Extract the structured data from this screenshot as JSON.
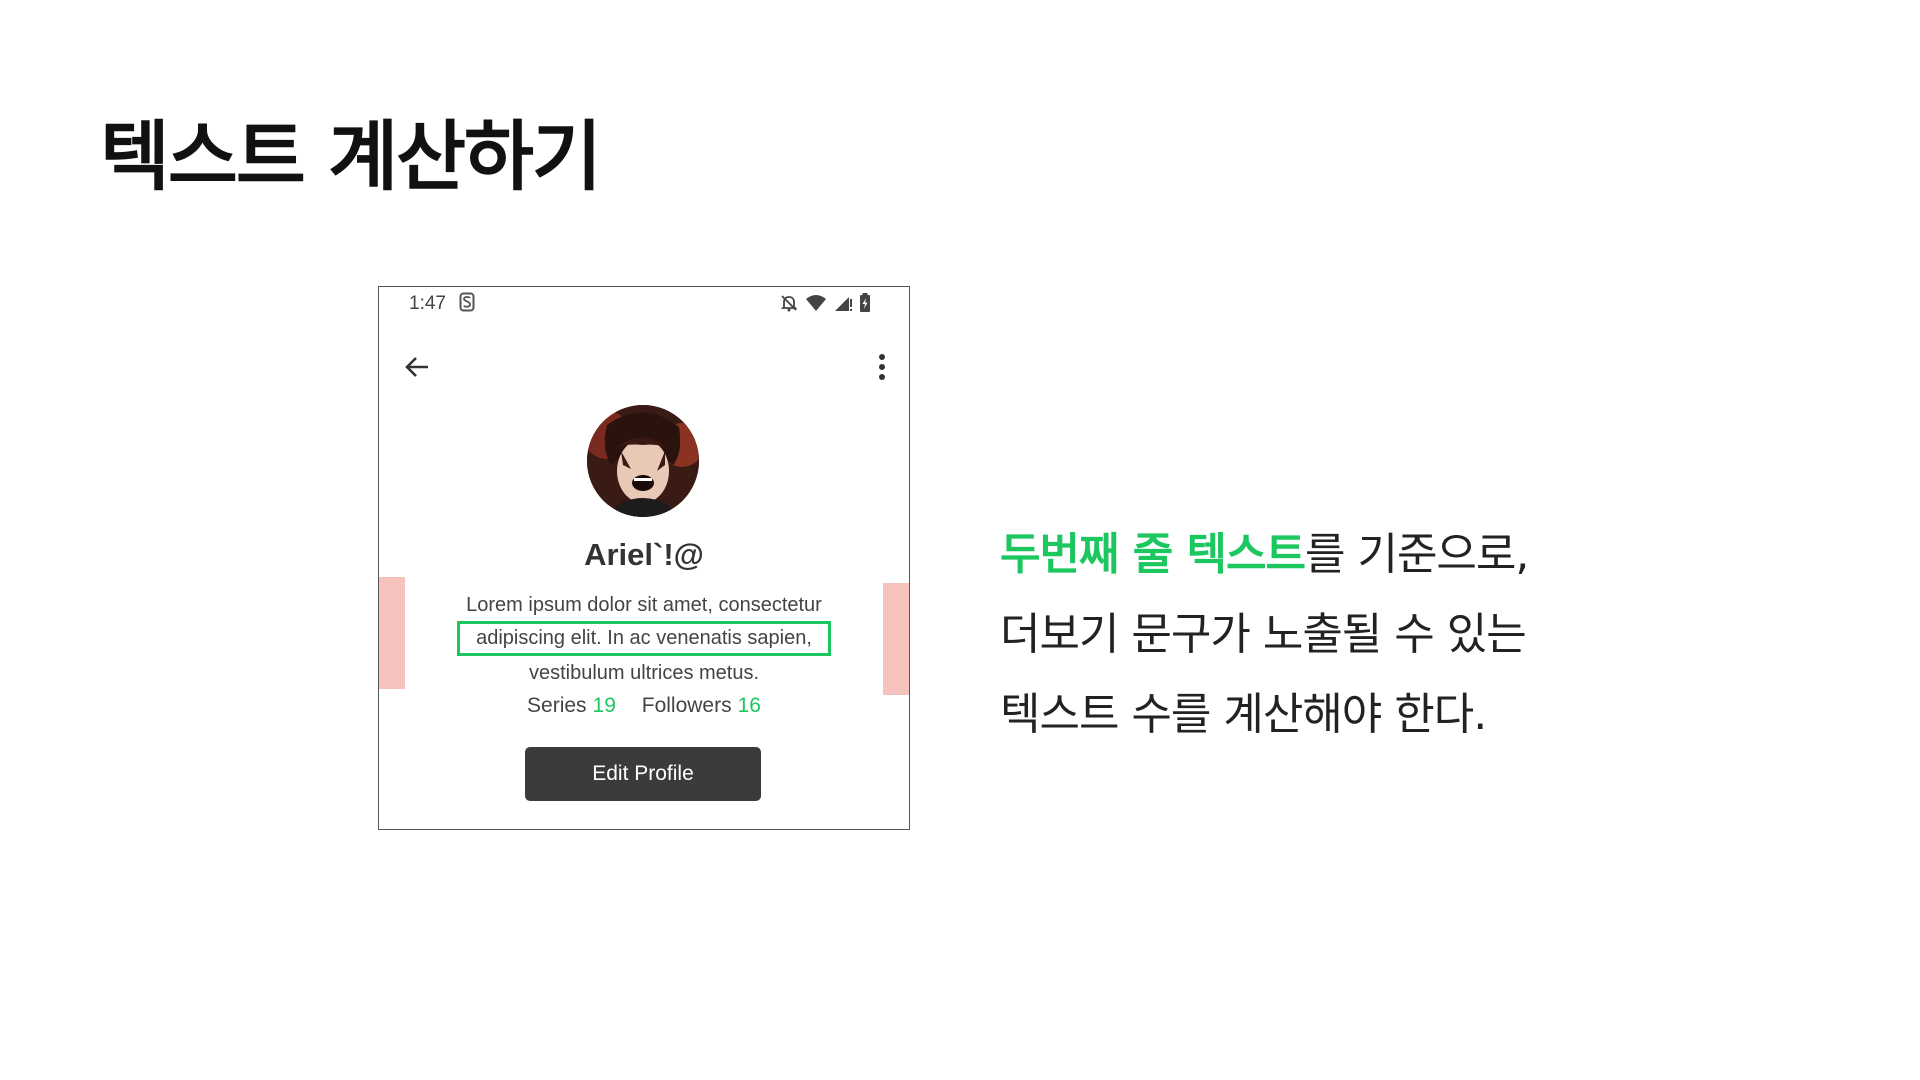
{
  "slide": {
    "title": "텍스트 계산하기"
  },
  "phone": {
    "status_bar": {
      "time": "1:47",
      "s_icon_glyph": "S",
      "icons": [
        "bell-off-icon",
        "wifi-icon",
        "signal-icon",
        "battery-charging-icon"
      ]
    },
    "toolbar": {
      "back_icon": "arrow-left-icon",
      "menu_icon": "more-vertical-icon"
    },
    "profile": {
      "display_name": "Ariel`!@",
      "bio_lines": [
        "Lorem ipsum dolor sit amet, consectetur",
        "adipiscing elit. In ac venenatis sapien,",
        "vestibulum ultrices metus."
      ],
      "stats": [
        {
          "label": "Series",
          "value": "19"
        },
        {
          "label": "Followers",
          "value": "16"
        }
      ],
      "edit_button_label": "Edit Profile"
    },
    "colors": {
      "highlight_green": "#1cc760",
      "margin_pink": "#f6c2bd",
      "button_dark": "#3b3b3b"
    }
  },
  "description": {
    "line1_highlight": "두번째 줄 텍스트",
    "line1_rest": "를 기준으로,",
    "line2": "더보기 문구가 노출될 수 있는",
    "line3": "텍스트 수를 계산해야 한다."
  }
}
